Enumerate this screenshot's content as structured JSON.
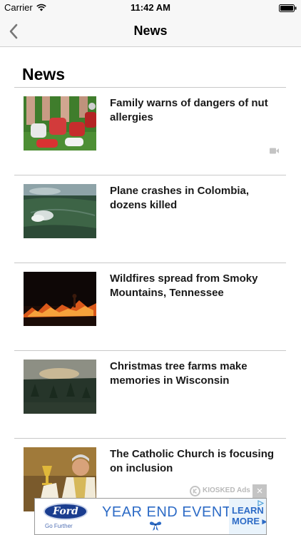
{
  "status_bar": {
    "carrier": "Carrier",
    "time": "11:42 AM"
  },
  "nav": {
    "title": "News",
    "back_icon": "chevron-left-icon"
  },
  "section": {
    "heading": "News"
  },
  "articles": [
    {
      "title": "Family warns of dangers of nut allergies",
      "thumbnail": "sneakers-on-grass",
      "has_video": true
    },
    {
      "title": "Plane crashes in Colombia, dozens killed",
      "thumbnail": "jungle-aerial-view",
      "has_video": false
    },
    {
      "title": "Wildfires spread from Smoky Mountains, Tennessee",
      "thumbnail": "fire-at-night",
      "has_video": false
    },
    {
      "title": "Christmas tree farms make memories in Wisconsin",
      "thumbnail": "tree-farm-dusk",
      "has_video": false
    },
    {
      "title": "The Catholic Church is focusing on inclusion",
      "thumbnail": "priest-with-chalice",
      "has_video": false
    }
  ],
  "ad": {
    "label": "KIOSKED Ads",
    "close": "×",
    "brand": "Ford",
    "tagline": "Go Further",
    "headline": "YEAR END EVENT",
    "cta_line1": "LEARN",
    "cta_line2": "MORE ▸"
  },
  "colors": {
    "bar_background": "#f7f7f7",
    "separator": "#c8c8c8",
    "ad_blue": "#2d6bc6",
    "ford_blue": "#1a3d8f"
  }
}
